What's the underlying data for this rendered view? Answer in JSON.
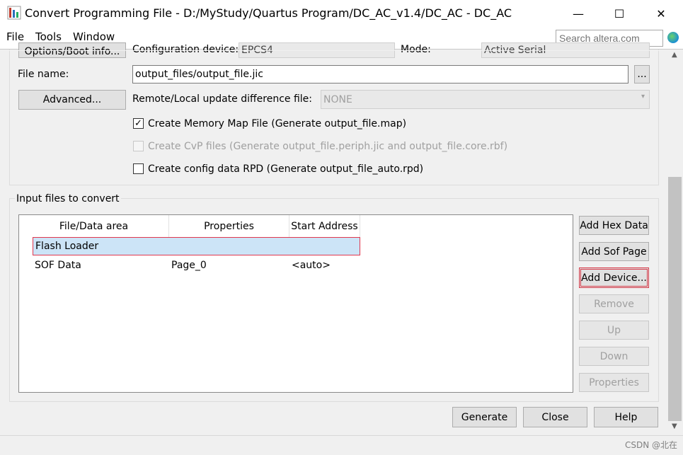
{
  "window": {
    "title": "Convert Programming File - D:/MyStudy/Quartus Program/DC_AC_v1.4/DC_AC - DC_AC",
    "minimize_glyph": "—",
    "maximize_glyph": "☐",
    "close_glyph": "✕"
  },
  "menu": {
    "file_label": "File",
    "tools_label": "Tools",
    "window_label": "Window",
    "search_placeholder": "Search altera.com"
  },
  "output": {
    "options_button": "Options/Boot info...",
    "config_device_label": "Configuration device:",
    "config_device_value": "EPCS4",
    "mode_label": "Mode:",
    "mode_value": "Active Serial",
    "file_name_label": "File name:",
    "file_name_value": "output_files/output_file.jic",
    "browse_label": "...",
    "advanced_button": "Advanced...",
    "remote_label": "Remote/Local update difference file:",
    "remote_value": "NONE",
    "checkbox_memory_map": {
      "label": "Create Memory Map File (Generate output_file.map)",
      "checked": true,
      "enabled": true
    },
    "checkbox_cvp": {
      "label": "Create CvP files (Generate output_file.periph.jic and output_file.core.rbf)",
      "checked": false,
      "enabled": false
    },
    "checkbox_rpd": {
      "label": "Create config data RPD (Generate output_file_auto.rpd)",
      "checked": false,
      "enabled": true
    }
  },
  "input": {
    "group_title": "Input files to convert",
    "columns": [
      "File/Data area",
      "Properties",
      "Start Address"
    ],
    "rows": [
      {
        "name": "Flash Loader",
        "properties": "",
        "start": "",
        "selected": true
      },
      {
        "name": "SOF Data",
        "properties": "Page_0",
        "start": "<auto>",
        "selected": false
      }
    ],
    "buttons": {
      "add_hex": "Add Hex Data",
      "add_sof_page": "Add Sof Page",
      "add_device": "Add Device...",
      "remove": "Remove",
      "up": "Up",
      "down": "Down",
      "properties": "Properties"
    }
  },
  "footer": {
    "generate": "Generate",
    "close": "Close",
    "help": "Help"
  },
  "watermark": "CSDN @北在"
}
